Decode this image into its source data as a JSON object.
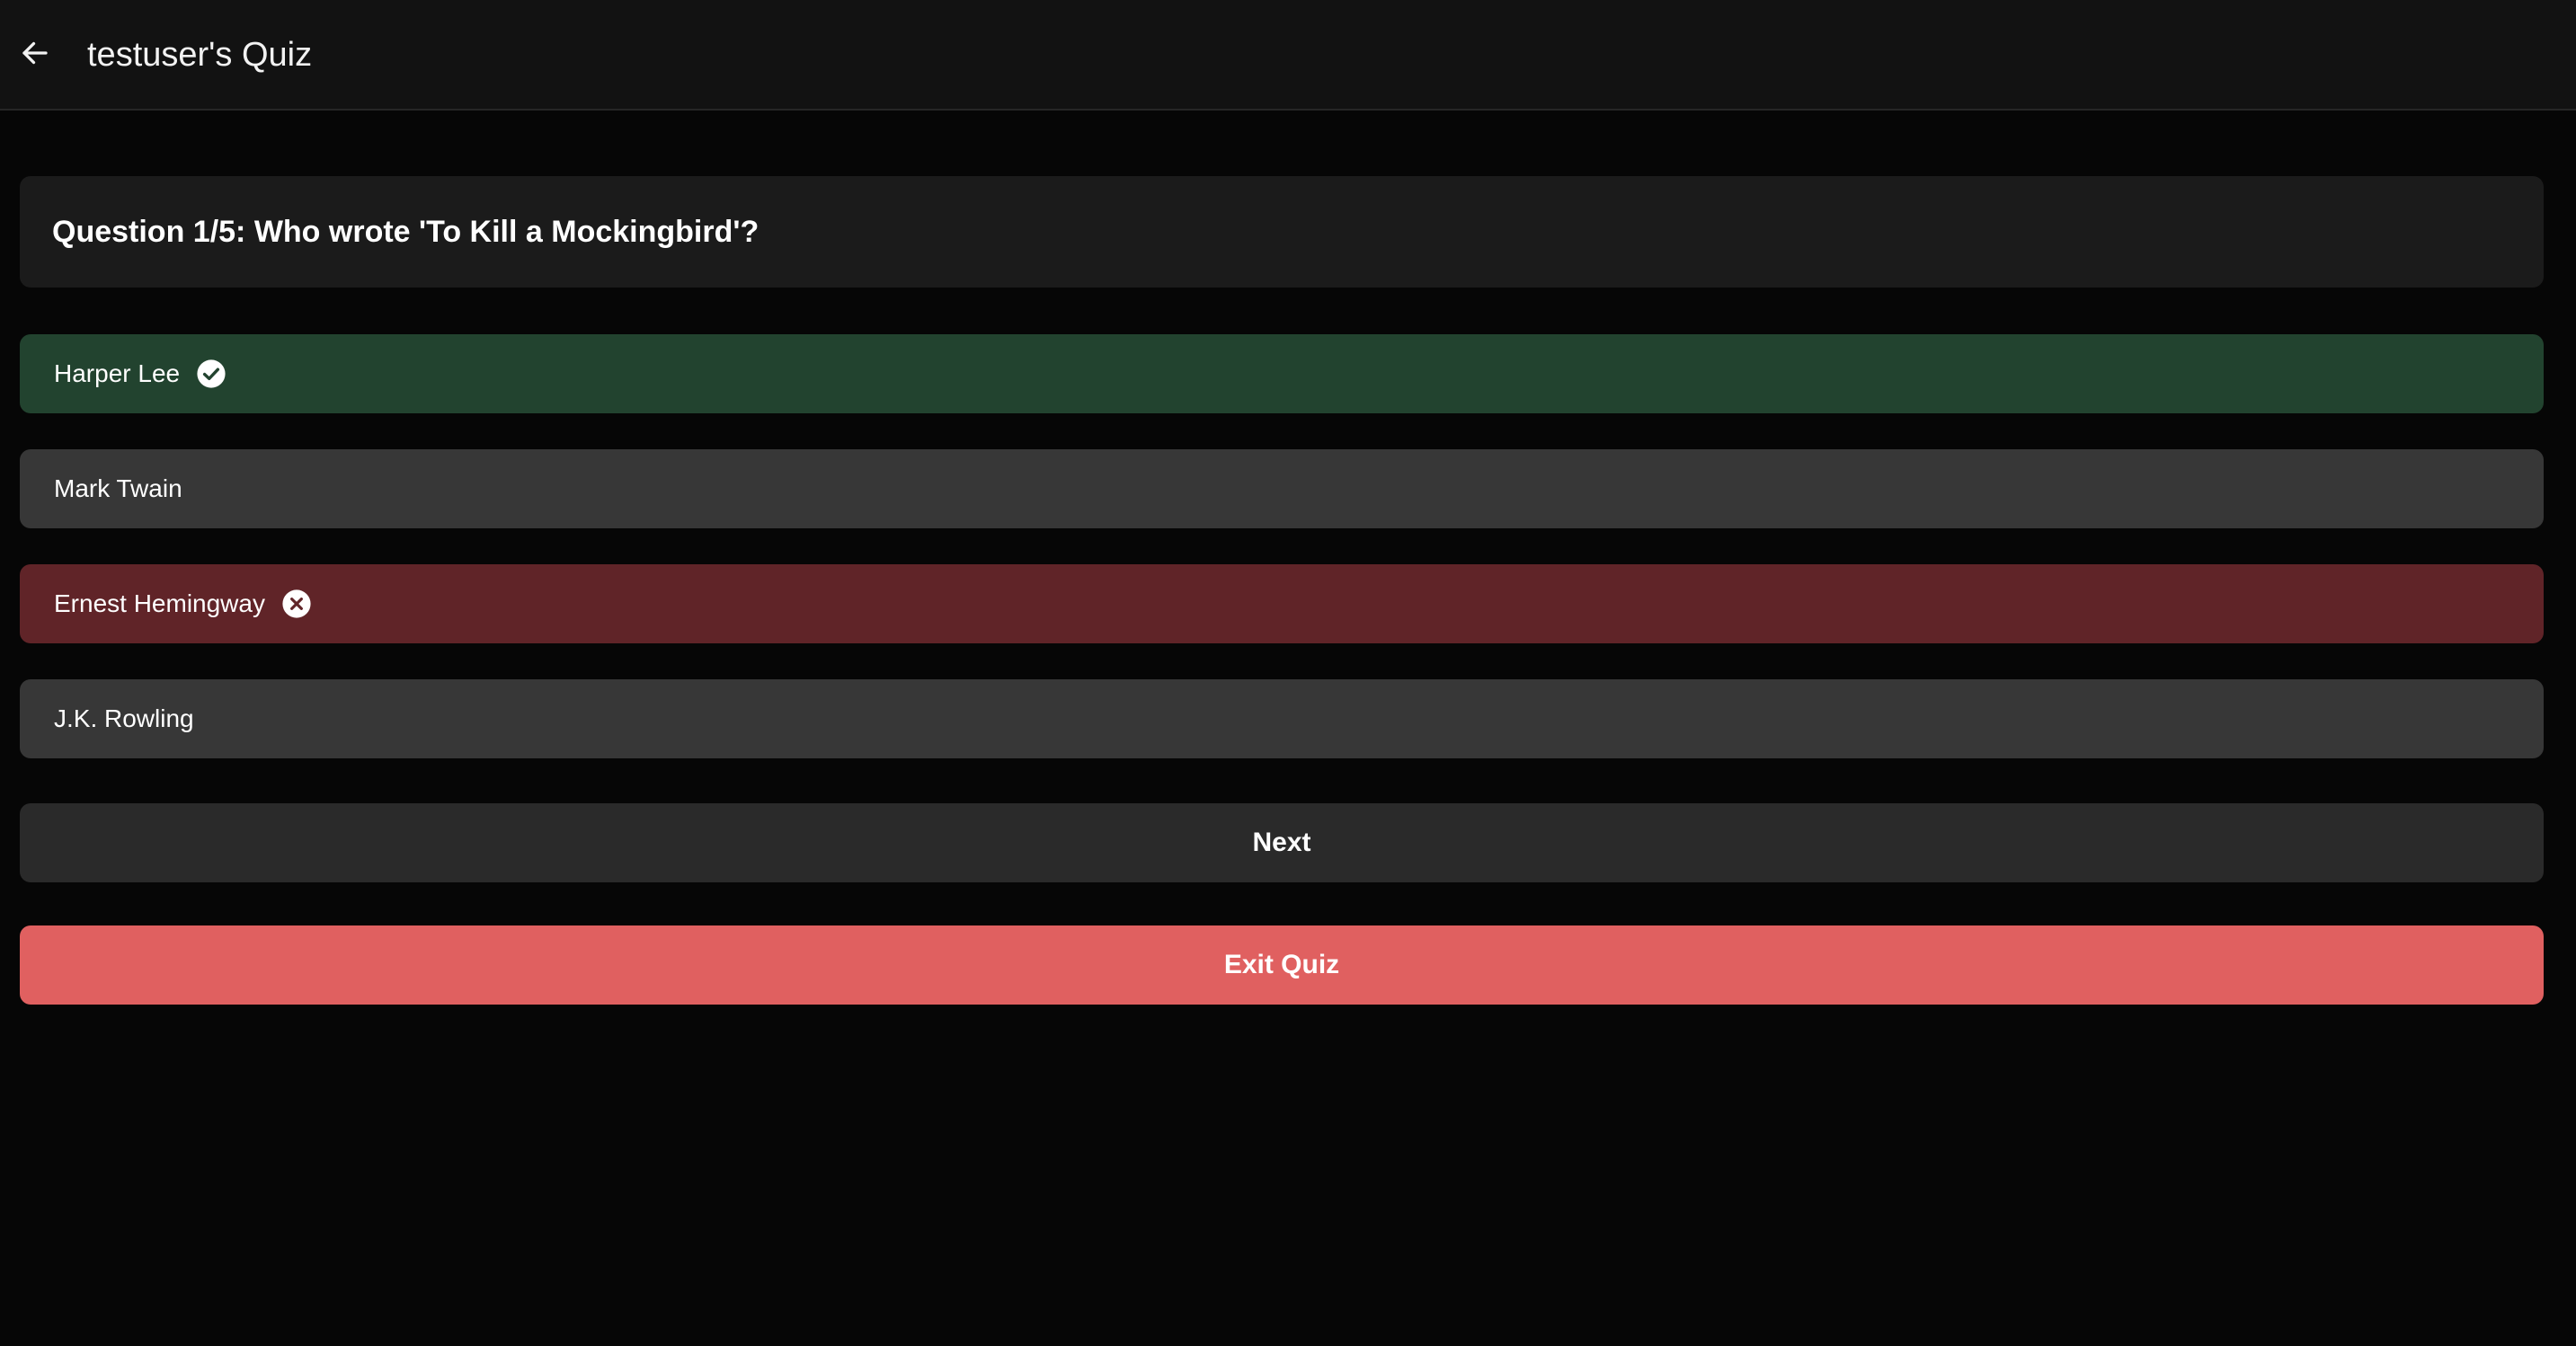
{
  "header": {
    "title": "testuser's Quiz",
    "back_icon": "arrow-left-icon"
  },
  "question": {
    "text": "Question 1/5: Who wrote 'To Kill a Mockingbird'?"
  },
  "options": [
    {
      "label": "Harper Lee",
      "state": "correct",
      "icon": "check-circle-icon",
      "color": "#22432f"
    },
    {
      "label": "Mark Twain",
      "state": "neutral",
      "icon": "",
      "color": "#373737"
    },
    {
      "label": "Ernest Hemingway",
      "state": "incorrect",
      "icon": "x-circle-icon",
      "color": "#602428"
    },
    {
      "label": "J.K. Rowling",
      "state": "neutral",
      "icon": "",
      "color": "#373737"
    }
  ],
  "actions": {
    "next_label": "Next",
    "exit_label": "Exit Quiz",
    "exit_color": "#e06060"
  }
}
